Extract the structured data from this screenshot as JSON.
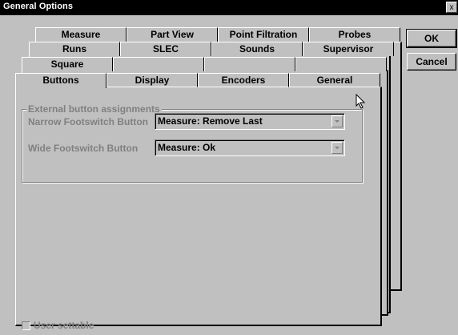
{
  "window": {
    "title": "General Options",
    "close_glyph": "x"
  },
  "tabs": {
    "row1": [
      "Measure",
      "Part View",
      "Point Filtration",
      "Probes"
    ],
    "row2": [
      "Runs",
      "SLEC",
      "Sounds",
      "Supervisor"
    ],
    "row3": [
      "Square",
      "",
      "",
      ""
    ],
    "row4": [
      "Buttons",
      "Display",
      "Encoders",
      "General"
    ],
    "active": "Buttons"
  },
  "buttons": {
    "ok": "OK",
    "cancel": "Cancel"
  },
  "group": {
    "legend": "External button assignments",
    "narrow_label": "Narrow Footswitch Button",
    "narrow_value": "Measure: Remove Last",
    "wide_label": "Wide Footswitch Button",
    "wide_value": "Measure: Ok"
  },
  "user_settable": {
    "label": "User settable",
    "checked": false
  }
}
